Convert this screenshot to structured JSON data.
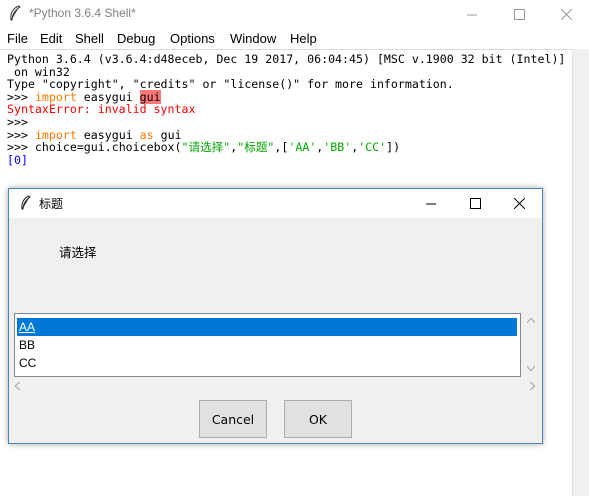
{
  "window": {
    "title": "*Python 3.6.4 Shell*",
    "menu": [
      "File",
      "Edit",
      "Shell",
      "Debug",
      "Options",
      "Window",
      "Help"
    ]
  },
  "shell": {
    "banner_line1": "Python 3.6.4 (v3.6.4:d48eceb, Dec 19 2017, 06:04:45) [MSC v.1900 32 bit (Intel)]",
    "banner_line2": " on win32",
    "banner_line3": "Type \"copyright\", \"credits\" or \"license()\" for more information.",
    "prompt": ">>>",
    "cmd1_kw": "import",
    "cmd1_mid": " easygui ",
    "cmd1_err": "gui",
    "error": "SyntaxError: invalid syntax",
    "cmd2_kw1": "import",
    "cmd2_mid": " easygui ",
    "cmd2_kw2": "as",
    "cmd2_end": " gui",
    "cmd3_pre": " choice=gui.choicebox(",
    "cmd3_s1": "\"请选择\"",
    "cmd3_c1": ",",
    "cmd3_s2": "\"标题\"",
    "cmd3_c2": ",[",
    "cmd3_s3": "'AA'",
    "cmd3_c3": ",",
    "cmd3_s4": "'BB'",
    "cmd3_c4": ",",
    "cmd3_s5": "'CC'",
    "cmd3_end": "])",
    "output": "[0]"
  },
  "dialog": {
    "title": "标题",
    "message": "请选择",
    "choices": [
      "AA",
      "BB",
      "CC"
    ],
    "selected": "AA",
    "cancel_label": "Cancel",
    "ok_label": "OK"
  },
  "colors": {
    "keyword": "#ff7700",
    "string": "#00aa00",
    "error": "#ff0000",
    "output": "#0000ff",
    "selection": "#0078d7"
  }
}
